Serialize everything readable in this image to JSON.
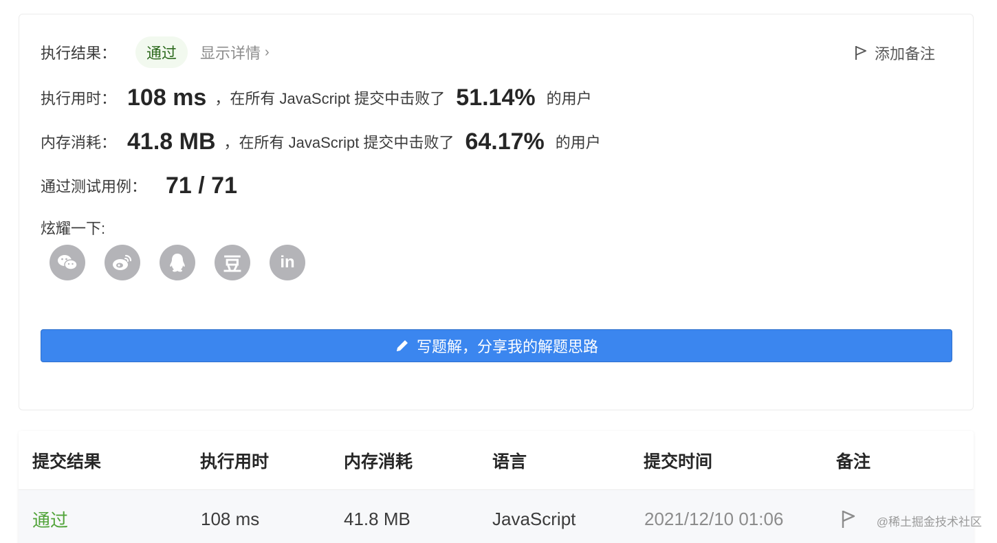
{
  "result": {
    "label": "执行结果：",
    "status": "通过",
    "detail": "显示详情",
    "add_note": "添加备注"
  },
  "runtime": {
    "label": "执行用时：",
    "value": "108 ms",
    "middle": "，在所有 JavaScript 提交中击败了",
    "percent": "51.14%",
    "suffix": "的用户"
  },
  "memory": {
    "label": "内存消耗：",
    "value": "41.8 MB",
    "middle": "，在所有 JavaScript 提交中击败了",
    "percent": "64.17%",
    "suffix": "的用户"
  },
  "testcases": {
    "label": "通过测试用例：",
    "value": "71 / 71"
  },
  "share": {
    "label": "炫耀一下:",
    "icons": [
      "wechat-icon",
      "weibo-icon",
      "qq-icon",
      "douban-icon",
      "linkedin-icon"
    ],
    "douban_glyph": "豆",
    "linkedin_glyph": "in"
  },
  "write_button": "写题解，分享我的解题思路",
  "history": {
    "headers": [
      "提交结果",
      "执行用时",
      "内存消耗",
      "语言",
      "提交时间",
      "备注"
    ],
    "row": {
      "result": "通过",
      "runtime": "108 ms",
      "memory": "41.8 MB",
      "language": "JavaScript",
      "time": "2021/12/10 01:06"
    }
  },
  "watermark": "@稀土掘金技术社区",
  "colors": {
    "accent": "#3b86ef",
    "pass": "#52a43a",
    "icon_gray": "#b4b4b8"
  }
}
